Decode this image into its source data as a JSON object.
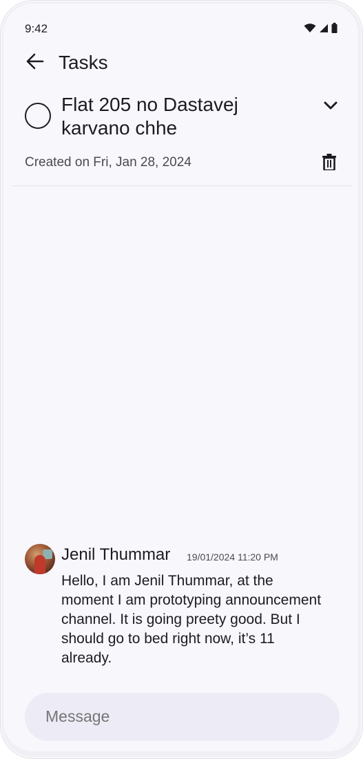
{
  "status_bar": {
    "time": "9:42",
    "icons": [
      "wifi-icon",
      "signal-icon",
      "battery-icon"
    ]
  },
  "app_bar": {
    "back_icon": "arrow-left-icon",
    "title": "Tasks"
  },
  "task": {
    "completed": false,
    "title": "Flat 205 no Dastavej karvano chhe",
    "expand_icon": "chevron-down-icon",
    "created_label": "Created on Fri, Jan 28, 2024",
    "delete_icon": "trash-icon"
  },
  "messages": [
    {
      "sender": "Jenil Thummar",
      "timestamp": "19/01/2024 11:20 PM",
      "text": "Hello, I am Jenil Thummar, at the moment I am prototyping announcement channel. It is going preety good. But I should go to bed right now, it’s 11 already."
    }
  ],
  "composer": {
    "placeholder": "Message"
  },
  "colors": {
    "background": "#f8f7fc",
    "composer_background": "#ecebf6",
    "text_primary": "#1c1b1f",
    "text_secondary": "#4a4950",
    "divider": "#e4e3e8"
  }
}
